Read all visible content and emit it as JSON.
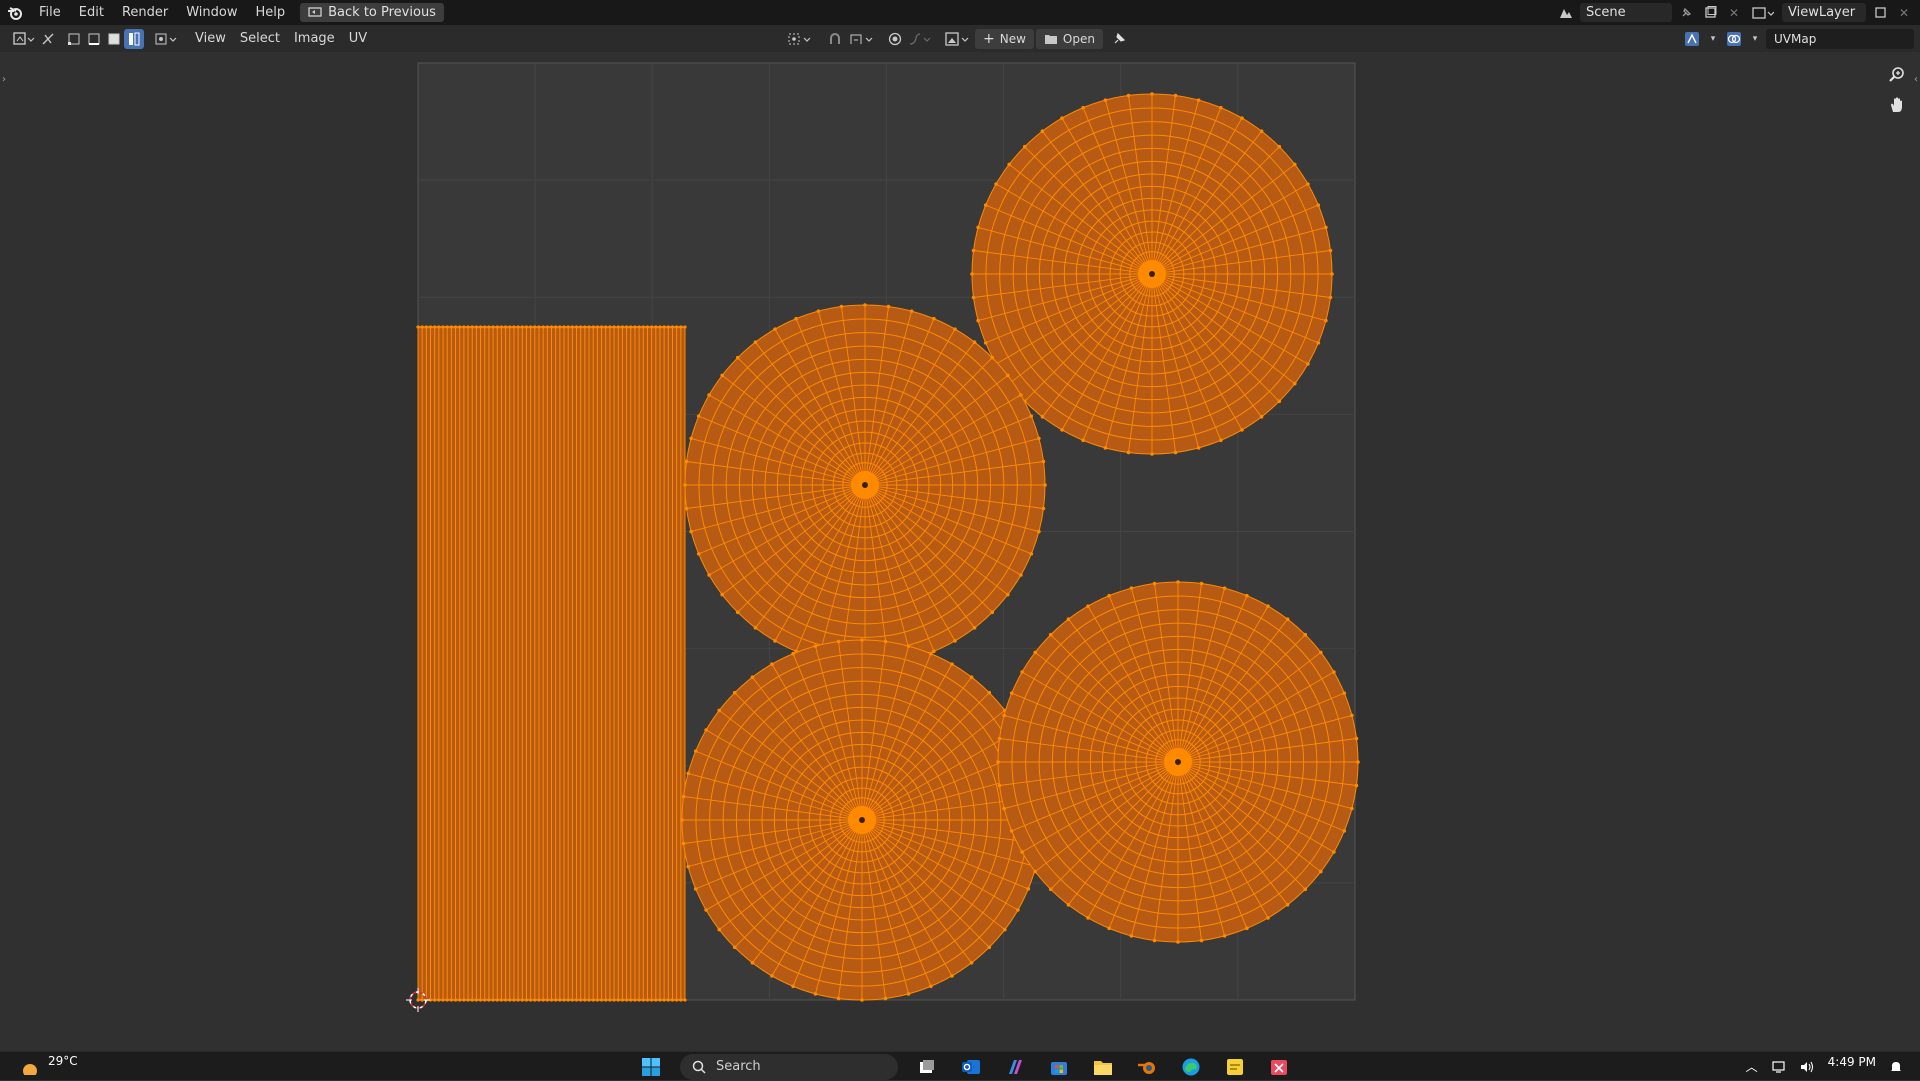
{
  "topbar": {
    "menus": [
      "File",
      "Edit",
      "Render",
      "Window",
      "Help"
    ],
    "back_label": "Back to Previous",
    "scene_label": "Scene",
    "viewlayer_label": "ViewLayer"
  },
  "editor": {
    "menus": [
      "View",
      "Select",
      "Image",
      "UV"
    ],
    "new_label": "New",
    "open_label": "Open",
    "uvmap_label": "UVMap"
  },
  "colors": {
    "accent": "#4772b3",
    "uv_face": "#b65a14",
    "uv_edge": "#ff8a00",
    "grid_bg": "#393939"
  },
  "icons": {
    "app": "blender-logo-icon",
    "zoom": "zoom-icon",
    "pan": "hand-icon"
  },
  "taskbar": {
    "weather_temp": "29°C",
    "search_placeholder": "Search",
    "time": "4:49 PM"
  }
}
